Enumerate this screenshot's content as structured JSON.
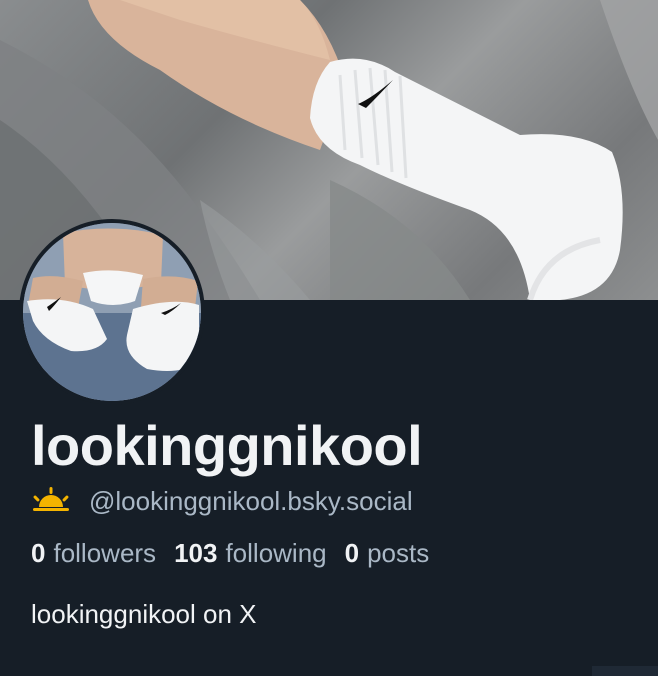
{
  "profile": {
    "display_name": "lookinggnikool",
    "handle": "@lookinggnikool.bsky.social",
    "bio": "lookinggnikool on X",
    "banner_icon": "banner-image",
    "avatar_icon": "avatar-image",
    "handle_icon": "sun-emoji-icon"
  },
  "stats": {
    "followers_count": "0",
    "followers_label": "followers",
    "following_count": "103",
    "following_label": "following",
    "posts_count": "0",
    "posts_label": "posts"
  },
  "colors": {
    "background": "#161e27",
    "text_primary": "#f1f3f5",
    "text_secondary": "#aab8c6",
    "sun_emoji": "#f4b400"
  }
}
